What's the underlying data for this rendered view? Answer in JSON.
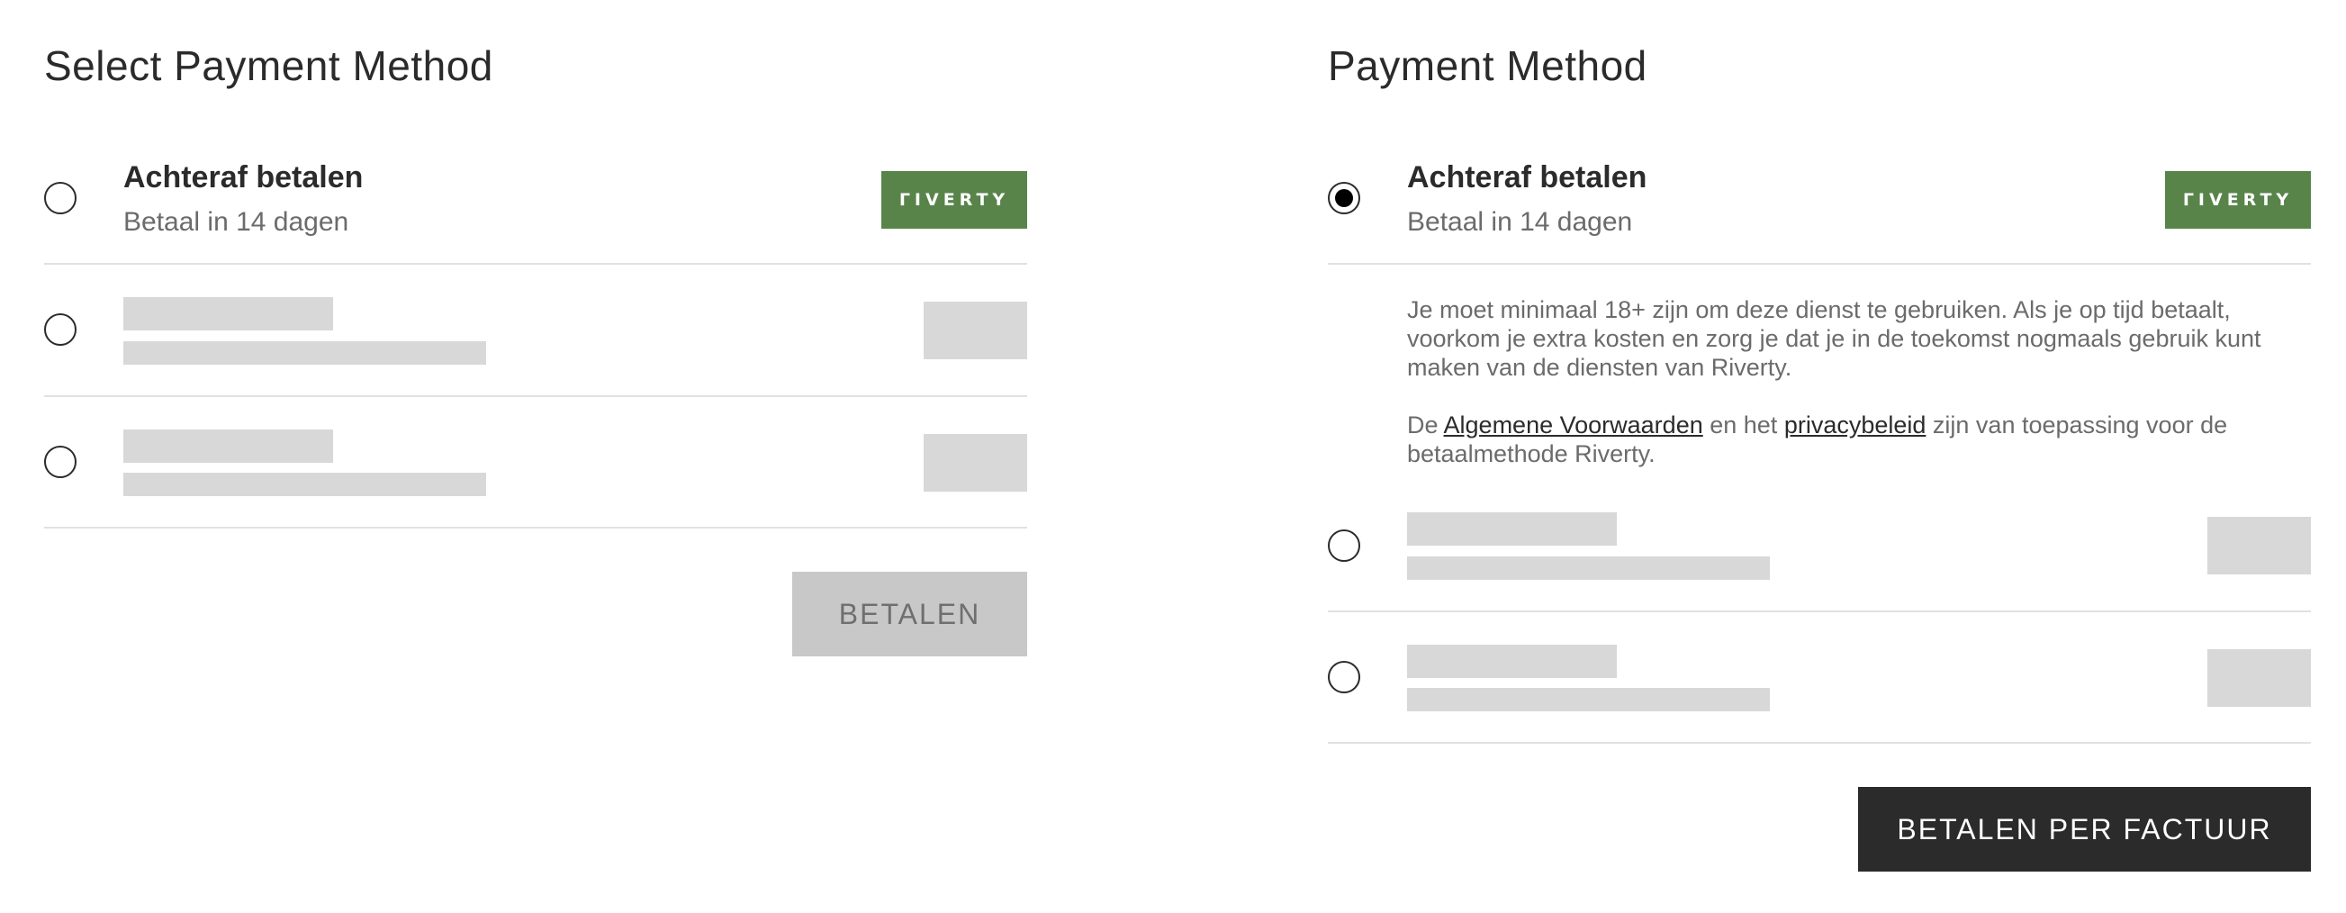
{
  "left_panel": {
    "title": "Select Payment Method",
    "option_afterpay": {
      "title": "Achteraf betalen",
      "subtitle": "Betaal in 14 dagen",
      "logo_text": "ΓIVERTY",
      "selected": false
    },
    "placeholder_option_count": 2,
    "pay_button_label": "BETALEN",
    "pay_button_enabled": false
  },
  "right_panel": {
    "title": "Payment Method",
    "option_afterpay": {
      "title": "Achteraf betalen",
      "subtitle": "Betaal in 14 dagen",
      "logo_text": "ΓIVERTY",
      "selected": true
    },
    "description": {
      "paragraph1": "Je moet minimaal 18+ zijn om deze dienst te gebruiken. Als je op tijd betaalt, voorkom je extra kosten en zorg je dat je in de toekomst nogmaals gebruik kunt maken van de diensten van Riverty.",
      "p2_prefix": "De ",
      "terms_link": "Algemene Voorwaarden",
      "p2_middle": " en het ",
      "privacy_link": "privacybeleid",
      "p2_suffix": " zijn van toepassing voor de betaalmethode Riverty."
    },
    "placeholder_option_count": 2,
    "pay_button_label": "BETALEN PER FACTUUR",
    "pay_button_enabled": true
  },
  "colors": {
    "text_primary": "#2b2b2b",
    "text_secondary": "#6b6b6b",
    "riverty_green": "#58844a",
    "placeholder_gray": "#d8d8d8",
    "divider": "#e1e1e1",
    "button_disabled_bg": "#c8c8c8",
    "button_active_bg": "#2b2b2b"
  },
  "icons": {
    "radio_unselected": "radio-empty-icon",
    "radio_selected": "radio-filled-icon"
  }
}
